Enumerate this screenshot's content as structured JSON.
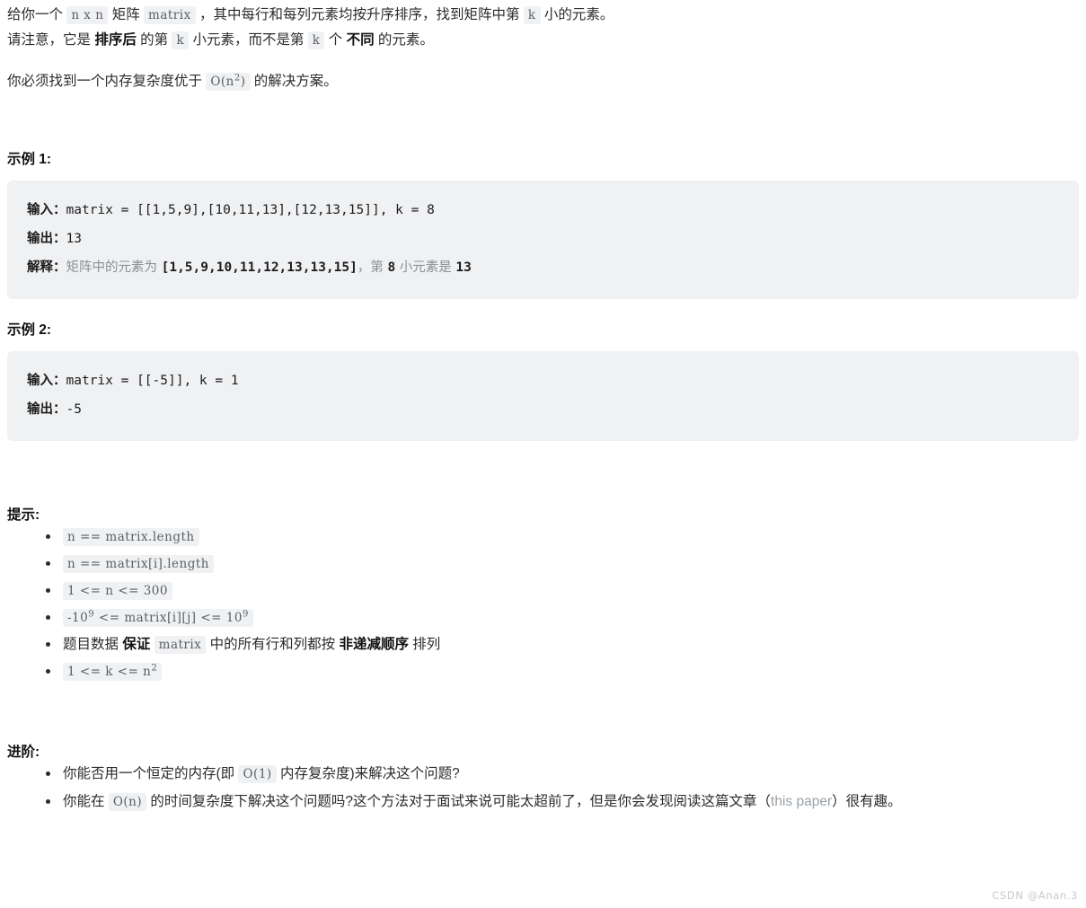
{
  "problem": {
    "intro": {
      "line1_a": "给你一个 ",
      "code_nxn": "n x n",
      "line1_b": " 矩阵 ",
      "code_matrix": "matrix",
      "line1_c": " ，其中每行和每列元素均按升序排序，找到矩阵中第 ",
      "code_k1": "k",
      "line1_d": " 小的元素。",
      "line2_a": "请注意，它是 ",
      "bold_sorted": "排序后",
      "line2_b": " 的第 ",
      "code_k2": "k",
      "line2_c": " 小元素，而不是第 ",
      "code_k3": "k",
      "line2_d": " 个 ",
      "bold_distinct": "不同",
      "line2_e": " 的元素。",
      "line3_a": "你必须找到一个内存复杂度优于 ",
      "code_on2_base": "O(n",
      "code_on2_sup": "2",
      "code_on2_close": ")",
      "line3_b": " 的解决方案。"
    },
    "examples": [
      {
        "heading": "示例 1:",
        "input_label": "输入：",
        "input_value": "matrix = [[1,5,9],[10,11,13],[12,13,15]], k = 8",
        "output_label": "输出：",
        "output_value": "13",
        "explain_label": "解释：",
        "explain_text_1": "矩阵中的元素为 ",
        "explain_code_1": "[1,5,9,10,11,12,13,13,15]",
        "explain_text_2": "，第 ",
        "explain_code_2": "8",
        "explain_text_3": " 小元素是 ",
        "explain_code_3": "13"
      },
      {
        "heading": "示例 2:",
        "input_label": "输入：",
        "input_value": "matrix = [[-5]], k = 1",
        "output_label": "输出：",
        "output_value": "-5"
      }
    ],
    "tips": {
      "heading": "提示:",
      "items": [
        {
          "kind": "code",
          "text": "n == matrix.length"
        },
        {
          "kind": "code",
          "text": "n == matrix[i].length"
        },
        {
          "kind": "code",
          "text": "1 <= n <= 300"
        },
        {
          "kind": "code-sup",
          "prefix": "-10",
          "sup1": "9",
          "middle": " <= matrix[i][j] <= 10",
          "sup2": "9"
        },
        {
          "kind": "mixed",
          "a": "题目数据 ",
          "bold1": "保证",
          "b": " ",
          "code": "matrix",
          "c": " 中的所有行和列都按 ",
          "bold2": "非递减顺序",
          "d": " 排列"
        },
        {
          "kind": "code-sup2",
          "prefix": "1 <= k <= n",
          "sup1": "2"
        }
      ]
    },
    "advanced": {
      "heading": "进阶:",
      "items": [
        {
          "a": "你能否用一个恒定的内存(即 ",
          "code": "O(1)",
          "b": " 内存复杂度)来解决这个问题?"
        },
        {
          "a": "你能在 ",
          "code": "O(n)",
          "b": " 的时间复杂度下解决这个问题吗?这个方法对于面试来说可能太超前了，但是你会发现阅读这篇文章（",
          "link": "this paper",
          "c": "）很有趣。"
        }
      ]
    }
  },
  "watermark": "CSDN @Anan.3",
  "colors": {
    "code_block_bg": "#f0f1f3",
    "inline_code_bg": "#f0f1f3",
    "inline_code_fg": "#5a5f66",
    "body_text": "#2b2b2b",
    "muted": "#8a8f96",
    "watermark": "#c7c9cc"
  }
}
